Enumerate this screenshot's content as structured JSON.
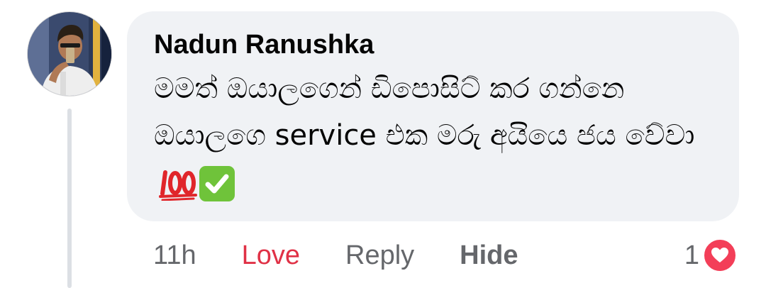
{
  "comment": {
    "author": "Nadun Ranushka",
    "text": "මමත් ඔයාලගෙන් ඩිපොසිට් කර ගන්නෙ ඔයාලගෙ service එක මරු අයියෙ ජය වේවා",
    "emojis": [
      "100-emoji-icon",
      "check-mark-emoji-icon"
    ]
  },
  "actions": {
    "time": "11h",
    "love": "Love",
    "reply": "Reply",
    "hide": "Hide"
  },
  "reactions": {
    "count": "1",
    "type": "heart-reaction-icon"
  },
  "colors": {
    "bubble": "#f0f2f5",
    "love_text": "#e03146",
    "muted_text": "#65676b",
    "heart": "#f33e58",
    "check": "#6fc33a",
    "hundred": "#e0262b"
  }
}
